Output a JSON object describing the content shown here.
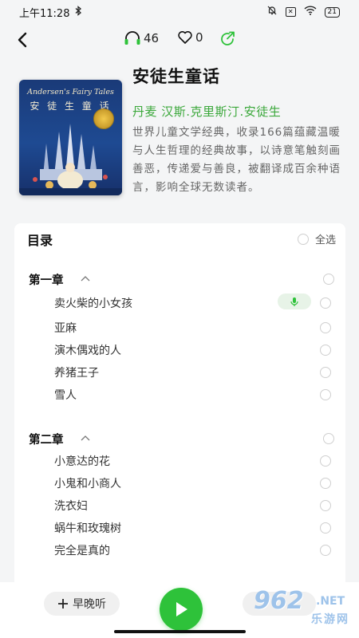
{
  "status_bar": {
    "time": "上午11:28",
    "sim_label": "✕",
    "battery": "21"
  },
  "nav": {
    "listen_count": "46",
    "like_count": "0"
  },
  "book": {
    "cover_title_en": "Andersen's Fairy Tales",
    "cover_title_zh": "安 徒 生 童 话",
    "title": "安徒生童话",
    "author": "丹麦 汉斯.克里斯汀.安徒生",
    "description": "世界儿童文学经典，收录166篇蕴藏温暖与人生哲理的经典故事，以诗意笔触刻画善恶，传递爱与善良，被翻译成百余种语言，影响全球无数读者。"
  },
  "toc": {
    "heading": "目录",
    "select_all": "全选",
    "chapters": [
      {
        "title": "第一章",
        "items": [
          "卖火柴的小女孩",
          "亚麻",
          "演木偶戏的人",
          "养猪王子",
          "雪人"
        ]
      },
      {
        "title": "第二章",
        "items": [
          "小意达的花",
          "小鬼和小商人",
          "洗衣妇",
          "蜗牛和玫瑰树",
          "完全是真的"
        ]
      }
    ]
  },
  "bottom": {
    "add_label": "早晚听"
  },
  "watermark": {
    "number": "962",
    "net": ".NET",
    "site": "乐游网"
  },
  "colors": {
    "accent": "#2ec23a",
    "author_green": "#3ba83b",
    "cover_blue": "#1e4a92"
  }
}
